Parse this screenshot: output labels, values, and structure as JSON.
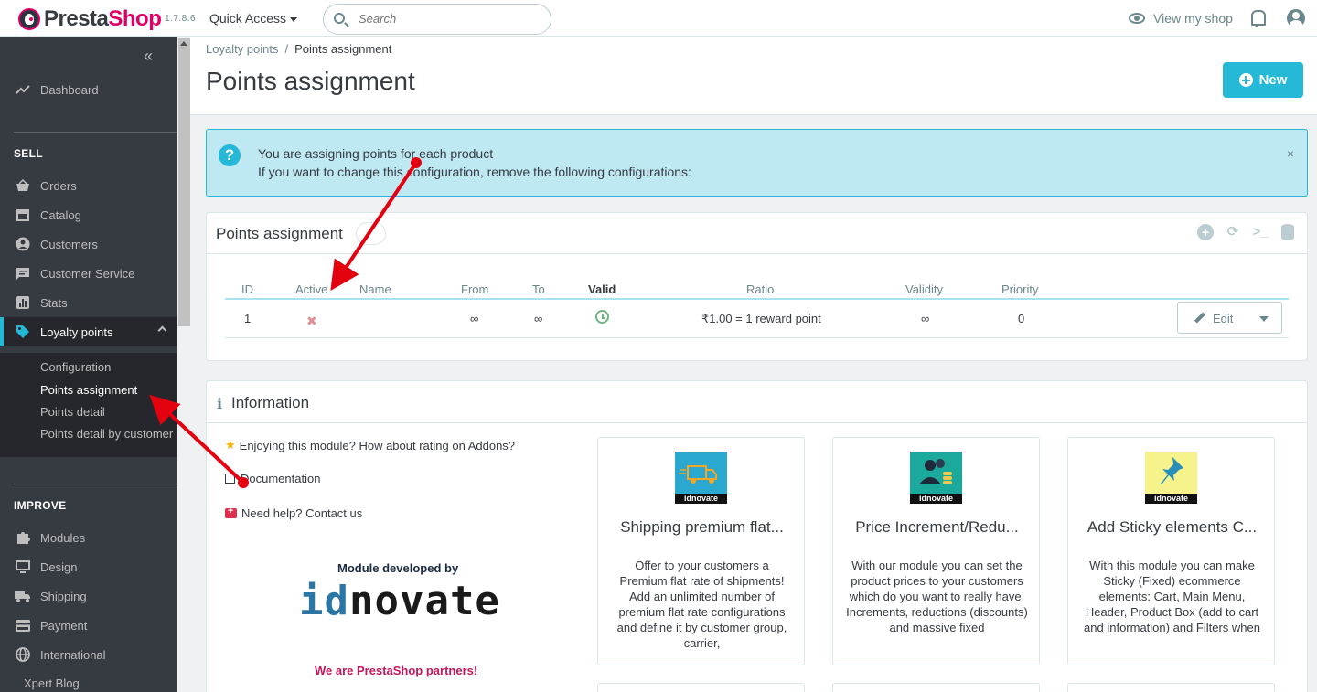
{
  "header": {
    "logo_text_1": "Presta",
    "logo_text_2": "Shop",
    "version": "1.7.8.6",
    "quick_access": "Quick Access",
    "search_placeholder": "Search",
    "view_shop": "View my shop"
  },
  "sidebar": {
    "dashboard": "Dashboard",
    "sell_label": "SELL",
    "sell_items": [
      "Orders",
      "Catalog",
      "Customers",
      "Customer Service",
      "Stats"
    ],
    "active_item": "Loyalty points",
    "submenu": [
      "Configuration",
      "Points assignment",
      "Points detail",
      "Points detail by customer"
    ],
    "improve_label": "IMPROVE",
    "improve_items": [
      "Modules",
      "Design",
      "Shipping",
      "Payment",
      "International"
    ],
    "last_item": "Xpert Blog"
  },
  "page": {
    "breadcrumb_parent": "Loyalty points",
    "breadcrumb_sep": "/",
    "breadcrumb_current": "Points assignment",
    "title": "Points assignment",
    "new_button": "New"
  },
  "alert": {
    "line1": "You are assigning points for each product",
    "line2": "If you want to change this configuration, remove the following configurations:",
    "close": "×"
  },
  "table_panel": {
    "title": "Points assignment",
    "columns": [
      "ID",
      "Active",
      "Name",
      "From",
      "To",
      "Valid",
      "Ratio",
      "Validity",
      "Priority"
    ],
    "row": {
      "id": "1",
      "active": "✖",
      "name": "",
      "from": "∞",
      "to": "∞",
      "ratio": "₹1.00 = 1 reward point",
      "validity": "∞",
      "priority": "0",
      "edit": "Edit"
    }
  },
  "info_panel": {
    "title": "Information",
    "links": [
      "Enjoying this module? How about rating on Addons?",
      "Documentation",
      "Need help? Contact us"
    ],
    "developed_by": "Module developed by",
    "brand_id": "id",
    "brand_rest": "novate",
    "partners": "We are PrestaShop partners!",
    "cards": [
      {
        "title": "Shipping premium flat...",
        "tag": "idnovate",
        "desc": "Offer to your customers a Premium flat rate of shipments! Add an unlimited number of premium flat rate configurations and define it by customer group, carrier,"
      },
      {
        "title": "Price Increment/Redu...",
        "tag": "idnovate",
        "desc": "With our module you can set the product prices to your customers which do you want to really have. Increments, reductions (discounts) and massive fixed"
      },
      {
        "title": "Add Sticky elements C...",
        "tag": "idnovate",
        "desc": "With this module you can make Sticky (Fixed) ecommerce elements: Cart, Main Menu, Header, Product Box (add to cart and information) and Filters when"
      }
    ]
  },
  "colors": {
    "accent": "#25b9d7",
    "brand_pink": "#df0067",
    "sidebar_bg": "#363a41",
    "annotation_arrow": "#e3000f"
  }
}
